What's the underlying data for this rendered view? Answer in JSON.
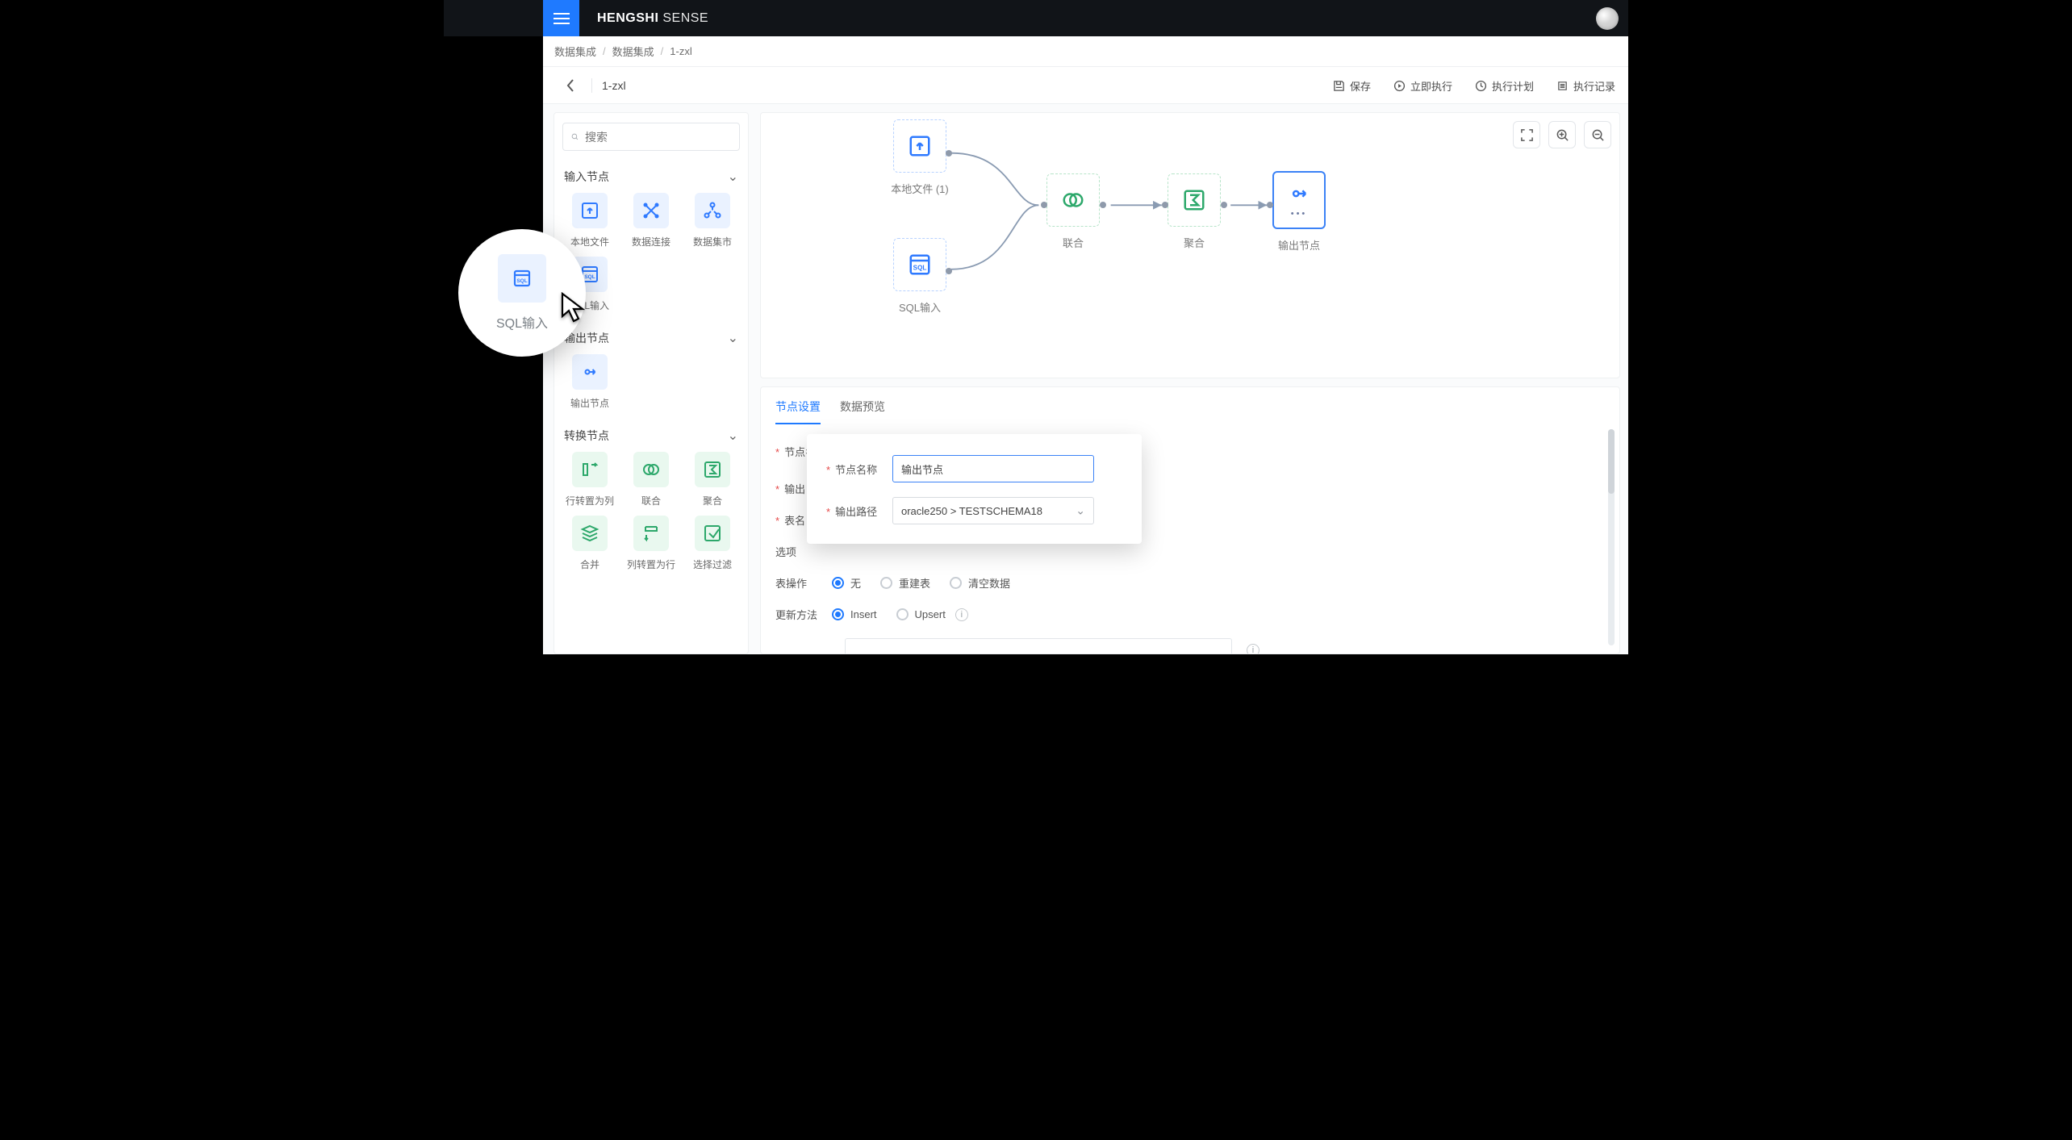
{
  "brand_bold": "HENGSHI",
  "brand_thin": " SENSE",
  "breadcrumb": {
    "root": "数据集成",
    "mid": "数据集成",
    "leaf": "1-zxl"
  },
  "toolbar": {
    "pipeline_name": "1-zxl",
    "save": "保存",
    "run_now": "立即执行",
    "schedule": "执行计划",
    "logs": "执行记录"
  },
  "palette": {
    "search_placeholder": "搜索",
    "group_input": "输入节点",
    "group_output": "输出节点",
    "group_transform": "转换节点",
    "nodes": {
      "local_file": "本地文件",
      "data_conn": "数据连接",
      "data_market": "数据集市",
      "sql_input": "SQL输入",
      "output_node": "输出节点",
      "row2col": "行转置为列",
      "union": "联合",
      "aggregate": "聚合",
      "merge": "合并",
      "col2row": "列转置为行",
      "select_filter": "选择过滤"
    }
  },
  "canvas": {
    "nodes": {
      "n1": "本地文件 (1)",
      "n2": "SQL输入",
      "n3": "联合",
      "n4": "聚合",
      "n5": "输出节点"
    }
  },
  "tabs": {
    "settings": "节点设置",
    "preview": "数据预览"
  },
  "form": {
    "label_name": "节点名称",
    "value_name": "输出节点",
    "label_output": "输出",
    "label_table": "表名",
    "label_options": "选项",
    "label_table_op": "表操作",
    "radios_tableop": {
      "none": "无",
      "rebuild": "重建表",
      "truncate": "清空数据"
    },
    "label_update": "更新方法",
    "radios_update": {
      "insert": "Insert",
      "upsert": "Upsert"
    }
  },
  "popover": {
    "label_name": "节点名称",
    "value_name": "输出节点",
    "label_path": "输出路径",
    "path_value": "oracle250 > TESTSCHEMA18"
  },
  "floating": {
    "label": "SQL输入"
  }
}
